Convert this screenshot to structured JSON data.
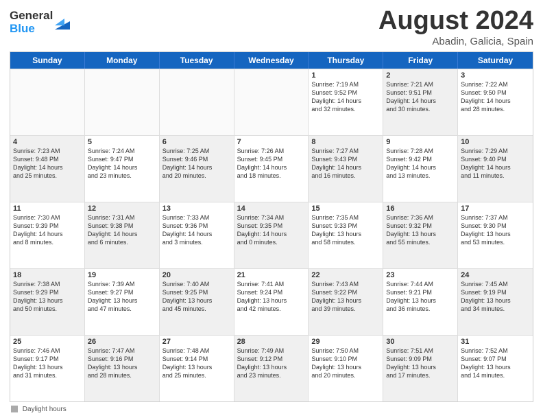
{
  "logo": {
    "general": "General",
    "blue": "Blue"
  },
  "title": "August 2024",
  "subtitle": "Abadin, Galicia, Spain",
  "days_of_week": [
    "Sunday",
    "Monday",
    "Tuesday",
    "Wednesday",
    "Thursday",
    "Friday",
    "Saturday"
  ],
  "footer_label": "Daylight hours",
  "weeks": [
    [
      {
        "day": "",
        "empty": true,
        "shaded": false
      },
      {
        "day": "",
        "empty": true,
        "shaded": false
      },
      {
        "day": "",
        "empty": true,
        "shaded": false
      },
      {
        "day": "",
        "empty": true,
        "shaded": false
      },
      {
        "day": "1",
        "empty": false,
        "shaded": false,
        "info": "Sunrise: 7:19 AM\nSunset: 9:52 PM\nDaylight: 14 hours\nand 32 minutes."
      },
      {
        "day": "2",
        "empty": false,
        "shaded": true,
        "info": "Sunrise: 7:21 AM\nSunset: 9:51 PM\nDaylight: 14 hours\nand 30 minutes."
      },
      {
        "day": "3",
        "empty": false,
        "shaded": false,
        "info": "Sunrise: 7:22 AM\nSunset: 9:50 PM\nDaylight: 14 hours\nand 28 minutes."
      }
    ],
    [
      {
        "day": "4",
        "empty": false,
        "shaded": true,
        "info": "Sunrise: 7:23 AM\nSunset: 9:48 PM\nDaylight: 14 hours\nand 25 minutes."
      },
      {
        "day": "5",
        "empty": false,
        "shaded": false,
        "info": "Sunrise: 7:24 AM\nSunset: 9:47 PM\nDaylight: 14 hours\nand 23 minutes."
      },
      {
        "day": "6",
        "empty": false,
        "shaded": true,
        "info": "Sunrise: 7:25 AM\nSunset: 9:46 PM\nDaylight: 14 hours\nand 20 minutes."
      },
      {
        "day": "7",
        "empty": false,
        "shaded": false,
        "info": "Sunrise: 7:26 AM\nSunset: 9:45 PM\nDaylight: 14 hours\nand 18 minutes."
      },
      {
        "day": "8",
        "empty": false,
        "shaded": true,
        "info": "Sunrise: 7:27 AM\nSunset: 9:43 PM\nDaylight: 14 hours\nand 16 minutes."
      },
      {
        "day": "9",
        "empty": false,
        "shaded": false,
        "info": "Sunrise: 7:28 AM\nSunset: 9:42 PM\nDaylight: 14 hours\nand 13 minutes."
      },
      {
        "day": "10",
        "empty": false,
        "shaded": true,
        "info": "Sunrise: 7:29 AM\nSunset: 9:40 PM\nDaylight: 14 hours\nand 11 minutes."
      }
    ],
    [
      {
        "day": "11",
        "empty": false,
        "shaded": false,
        "info": "Sunrise: 7:30 AM\nSunset: 9:39 PM\nDaylight: 14 hours\nand 8 minutes."
      },
      {
        "day": "12",
        "empty": false,
        "shaded": true,
        "info": "Sunrise: 7:31 AM\nSunset: 9:38 PM\nDaylight: 14 hours\nand 6 minutes."
      },
      {
        "day": "13",
        "empty": false,
        "shaded": false,
        "info": "Sunrise: 7:33 AM\nSunset: 9:36 PM\nDaylight: 14 hours\nand 3 minutes."
      },
      {
        "day": "14",
        "empty": false,
        "shaded": true,
        "info": "Sunrise: 7:34 AM\nSunset: 9:35 PM\nDaylight: 14 hours\nand 0 minutes."
      },
      {
        "day": "15",
        "empty": false,
        "shaded": false,
        "info": "Sunrise: 7:35 AM\nSunset: 9:33 PM\nDaylight: 13 hours\nand 58 minutes."
      },
      {
        "day": "16",
        "empty": false,
        "shaded": true,
        "info": "Sunrise: 7:36 AM\nSunset: 9:32 PM\nDaylight: 13 hours\nand 55 minutes."
      },
      {
        "day": "17",
        "empty": false,
        "shaded": false,
        "info": "Sunrise: 7:37 AM\nSunset: 9:30 PM\nDaylight: 13 hours\nand 53 minutes."
      }
    ],
    [
      {
        "day": "18",
        "empty": false,
        "shaded": true,
        "info": "Sunrise: 7:38 AM\nSunset: 9:29 PM\nDaylight: 13 hours\nand 50 minutes."
      },
      {
        "day": "19",
        "empty": false,
        "shaded": false,
        "info": "Sunrise: 7:39 AM\nSunset: 9:27 PM\nDaylight: 13 hours\nand 47 minutes."
      },
      {
        "day": "20",
        "empty": false,
        "shaded": true,
        "info": "Sunrise: 7:40 AM\nSunset: 9:25 PM\nDaylight: 13 hours\nand 45 minutes."
      },
      {
        "day": "21",
        "empty": false,
        "shaded": false,
        "info": "Sunrise: 7:41 AM\nSunset: 9:24 PM\nDaylight: 13 hours\nand 42 minutes."
      },
      {
        "day": "22",
        "empty": false,
        "shaded": true,
        "info": "Sunrise: 7:43 AM\nSunset: 9:22 PM\nDaylight: 13 hours\nand 39 minutes."
      },
      {
        "day": "23",
        "empty": false,
        "shaded": false,
        "info": "Sunrise: 7:44 AM\nSunset: 9:21 PM\nDaylight: 13 hours\nand 36 minutes."
      },
      {
        "day": "24",
        "empty": false,
        "shaded": true,
        "info": "Sunrise: 7:45 AM\nSunset: 9:19 PM\nDaylight: 13 hours\nand 34 minutes."
      }
    ],
    [
      {
        "day": "25",
        "empty": false,
        "shaded": false,
        "info": "Sunrise: 7:46 AM\nSunset: 9:17 PM\nDaylight: 13 hours\nand 31 minutes."
      },
      {
        "day": "26",
        "empty": false,
        "shaded": true,
        "info": "Sunrise: 7:47 AM\nSunset: 9:16 PM\nDaylight: 13 hours\nand 28 minutes."
      },
      {
        "day": "27",
        "empty": false,
        "shaded": false,
        "info": "Sunrise: 7:48 AM\nSunset: 9:14 PM\nDaylight: 13 hours\nand 25 minutes."
      },
      {
        "day": "28",
        "empty": false,
        "shaded": true,
        "info": "Sunrise: 7:49 AM\nSunset: 9:12 PM\nDaylight: 13 hours\nand 23 minutes."
      },
      {
        "day": "29",
        "empty": false,
        "shaded": false,
        "info": "Sunrise: 7:50 AM\nSunset: 9:10 PM\nDaylight: 13 hours\nand 20 minutes."
      },
      {
        "day": "30",
        "empty": false,
        "shaded": true,
        "info": "Sunrise: 7:51 AM\nSunset: 9:09 PM\nDaylight: 13 hours\nand 17 minutes."
      },
      {
        "day": "31",
        "empty": false,
        "shaded": false,
        "info": "Sunrise: 7:52 AM\nSunset: 9:07 PM\nDaylight: 13 hours\nand 14 minutes."
      }
    ]
  ]
}
